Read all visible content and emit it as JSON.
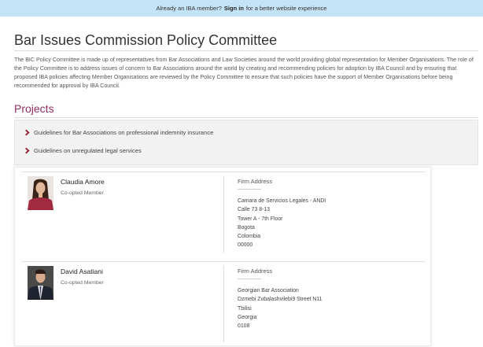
{
  "banner": {
    "before": "Already an IBA member?",
    "signin": "Sign in",
    "after": "for a better website experience"
  },
  "page": {
    "title": "Bar Issues Commission Policy Committee",
    "intro": "The BIC Policy Committee is made up of representatives from Bar Associations and Law Societies around the world providing global representation for Member Organisations. The role of the Policy Committee is to address issues of concern to Bar Associations around the world by creating and recommending policies for adoption by IBA Council and by ensuring that proposed IBA policies affecting Member Organisations are reviewed by the Policy Committee to ensure that such policies have the support of Member Organisations before being recommended for approval by IBA Council."
  },
  "projects": {
    "heading": "Projects",
    "items": [
      {
        "label": "Guidelines for Bar Associations on professional indemnity insurance"
      },
      {
        "label": "Guidelines on unregulated legal services"
      }
    ]
  },
  "members": [
    {
      "name": "Claudia Amore",
      "role": "Co-opted Member",
      "address_label": "Firm Address",
      "address": [
        "Camara de Servicios Legales - ANDI",
        "Calle 73 8-13",
        "Tower A - 7th Floor",
        "Bogota",
        "Colombia",
        "00000"
      ]
    },
    {
      "name": "David Asatiani",
      "role": "Co-opted Member",
      "address_label": "Firm Address",
      "address": [
        "Georgian Bar Association",
        "Dzmebi Zubalashvilebi9 Street N11",
        "Tbilisi",
        "Georgia",
        "0108"
      ]
    }
  ],
  "icons": {
    "chevron": "chevron-right-icon"
  },
  "colors": {
    "banner_bg": "#c5e3f6",
    "accent": "#8e2b5f",
    "chevron": "#8e1b2b"
  }
}
